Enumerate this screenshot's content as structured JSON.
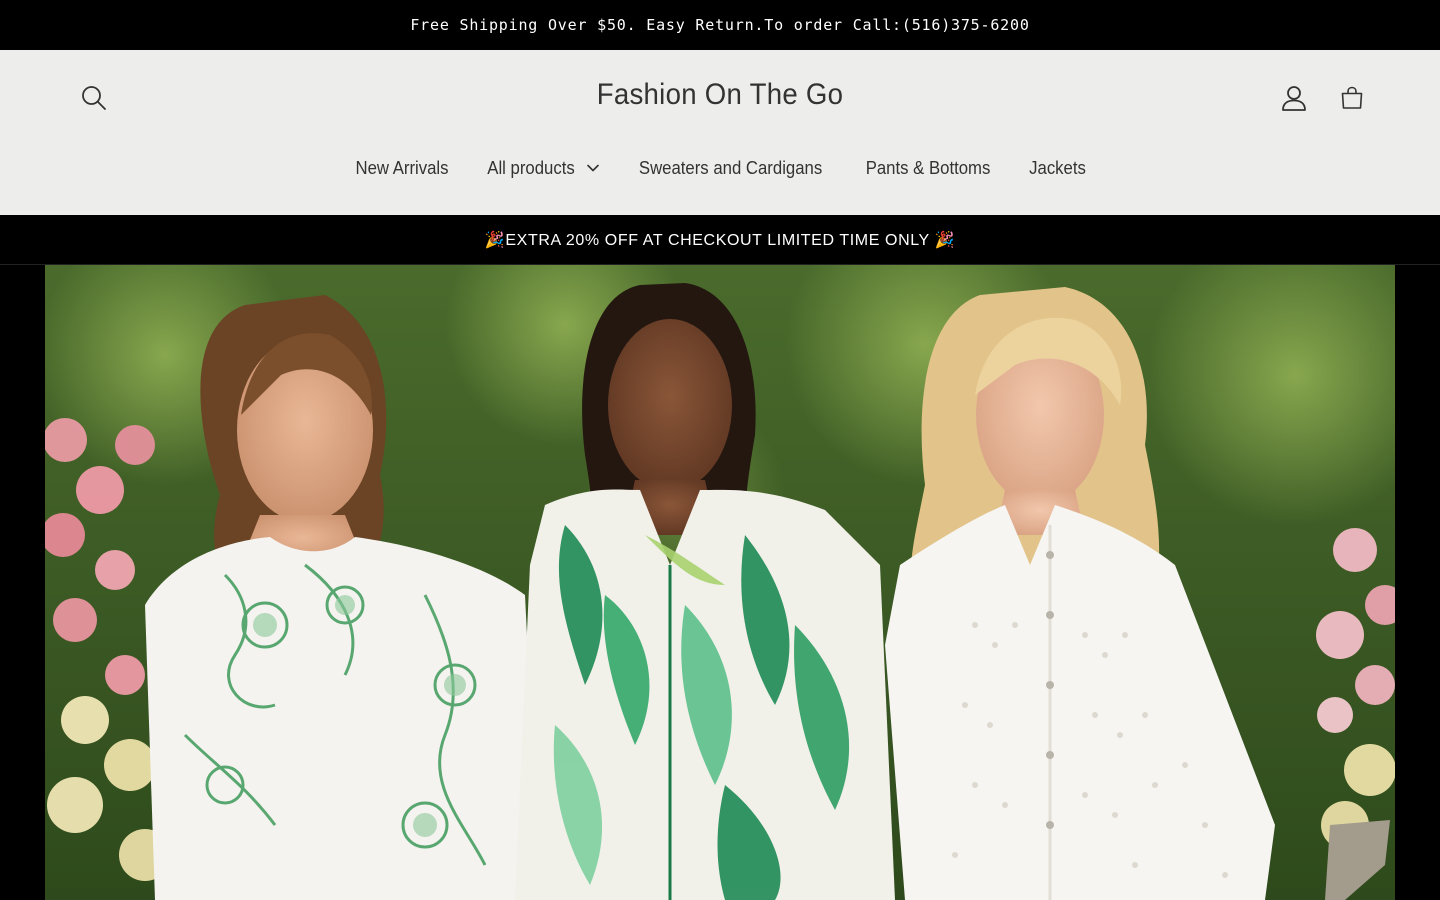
{
  "announcement": {
    "text": "Free Shipping Over $50. Easy Return.To order Call:(516)375-6200"
  },
  "header": {
    "store_name": "Fashion On The Go",
    "icons": {
      "search": "search-icon",
      "account": "account-icon",
      "cart": "cart-icon"
    }
  },
  "nav": {
    "items": [
      {
        "label": "New Arrivals"
      },
      {
        "label": "All products",
        "has_dropdown": true
      },
      {
        "label": "Sweaters and Cardigans"
      },
      {
        "label": "Pants & Bottoms"
      },
      {
        "label": "Jackets"
      }
    ]
  },
  "promo": {
    "text": "🎉EXTRA 20% OFF AT CHECKOUT LIMITED TIME ONLY 🎉"
  },
  "hero": {
    "image": "three-women-in-garden-photo"
  },
  "colors": {
    "announcement_bg": "#000000",
    "header_bg": "#ededec",
    "text": "#333333",
    "promo_bg": "#000000"
  }
}
